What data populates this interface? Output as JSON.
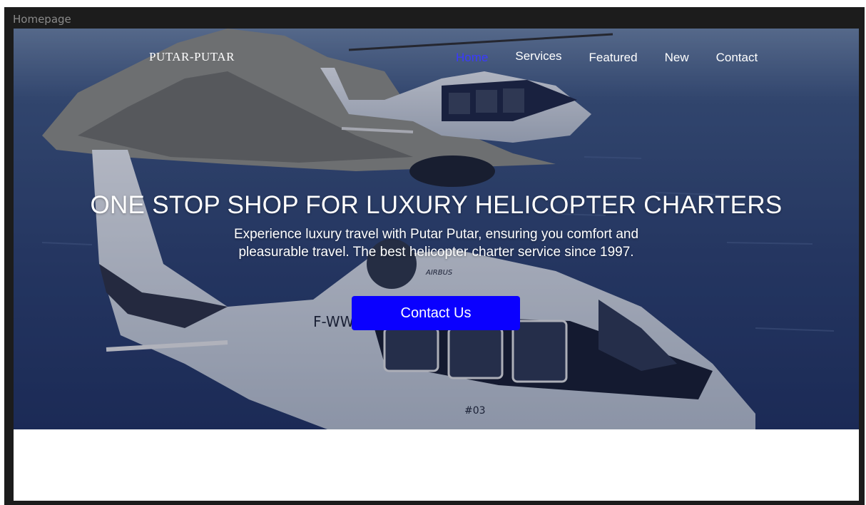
{
  "frame": {
    "label": "Homepage"
  },
  "header": {
    "brand": "PUTAR-PUTAR",
    "nav": [
      "Home",
      "Services",
      "Featured",
      "New",
      "Contact"
    ],
    "active_nav": "Home"
  },
  "hero": {
    "headline": "ONE STOP SHOP FOR LUXURY HELICOPTER CHARTERS",
    "subtitle_line1": "Experience luxury travel with Putar Putar, ensuring you comfort and",
    "subtitle_line2": "pleasurable travel. The best helicopter charter service since 1997.",
    "cta_label": "Contact Us",
    "image_texts": {
      "registration": "F-WWPA",
      "maker": "AIRBUS",
      "number": "#03"
    }
  },
  "colors": {
    "frame": "#1c1c1c",
    "cta": "#0a00ff",
    "active_nav": "#3a3aff",
    "sea": "#2a3f6e"
  }
}
